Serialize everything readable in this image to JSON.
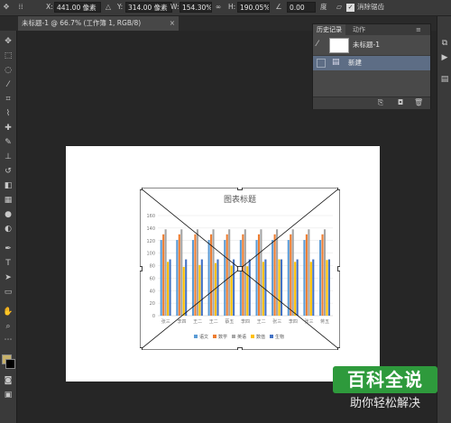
{
  "options_bar": {
    "x_label": "X:",
    "x_value": "441.00 像素",
    "y_label": "Y:",
    "y_value": "314.00 像素",
    "w_label": "W:",
    "w_value": "154.30%",
    "link_glyph": "∞",
    "h_label": "H:",
    "h_value": "190.05%",
    "angle_value": "0.00",
    "angle_unit": "度",
    "interp_label": "消除锯齿"
  },
  "document": {
    "tab_title": "未标题-1 @ 66.7% (工作簿 1, RGB/8)",
    "close_glyph": "×"
  },
  "history_panel": {
    "tabs": [
      "历史记录",
      "动作"
    ],
    "active_tab": 0,
    "snapshot_name": "未标题-1",
    "items": [
      {
        "label": "新建"
      }
    ]
  },
  "chart_data": {
    "type": "bar",
    "title": "图表标题",
    "categories": [
      "张三",
      "李四",
      "王二",
      "王二",
      "蔡五",
      "李四",
      "王二",
      "张三",
      "李四",
      "张三",
      "蒋五"
    ],
    "series": [
      {
        "name": "语文",
        "color": "#5b9bd5",
        "values": [
          121,
          121,
          121,
          121,
          121,
          121,
          121,
          121,
          121,
          121,
          121
        ]
      },
      {
        "name": "数学",
        "color": "#ed7d31",
        "values": [
          130,
          130,
          130,
          130,
          130,
          130,
          130,
          130,
          130,
          130,
          130
        ]
      },
      {
        "name": "英语",
        "color": "#a5a5a5",
        "values": [
          138,
          138,
          138,
          138,
          138,
          138,
          138,
          138,
          138,
          138,
          138
        ]
      },
      {
        "name": "数值",
        "color": "#ffc000",
        "values": [
          86,
          78,
          81,
          84,
          80,
          79,
          86,
          90,
          86,
          86,
          89
        ]
      },
      {
        "name": "生物",
        "color": "#4472c4",
        "values": [
          90,
          90,
          90,
          90,
          90,
          90,
          90,
          90,
          90,
          90,
          90
        ]
      }
    ],
    "ylim": [
      0,
      160
    ],
    "yticks": [
      0,
      20,
      40,
      60,
      80,
      100,
      120,
      140,
      160
    ],
    "grid": true,
    "legend": "bottom"
  },
  "watermark": {
    "title": "百科全说",
    "subtitle": "助你轻松解决"
  }
}
